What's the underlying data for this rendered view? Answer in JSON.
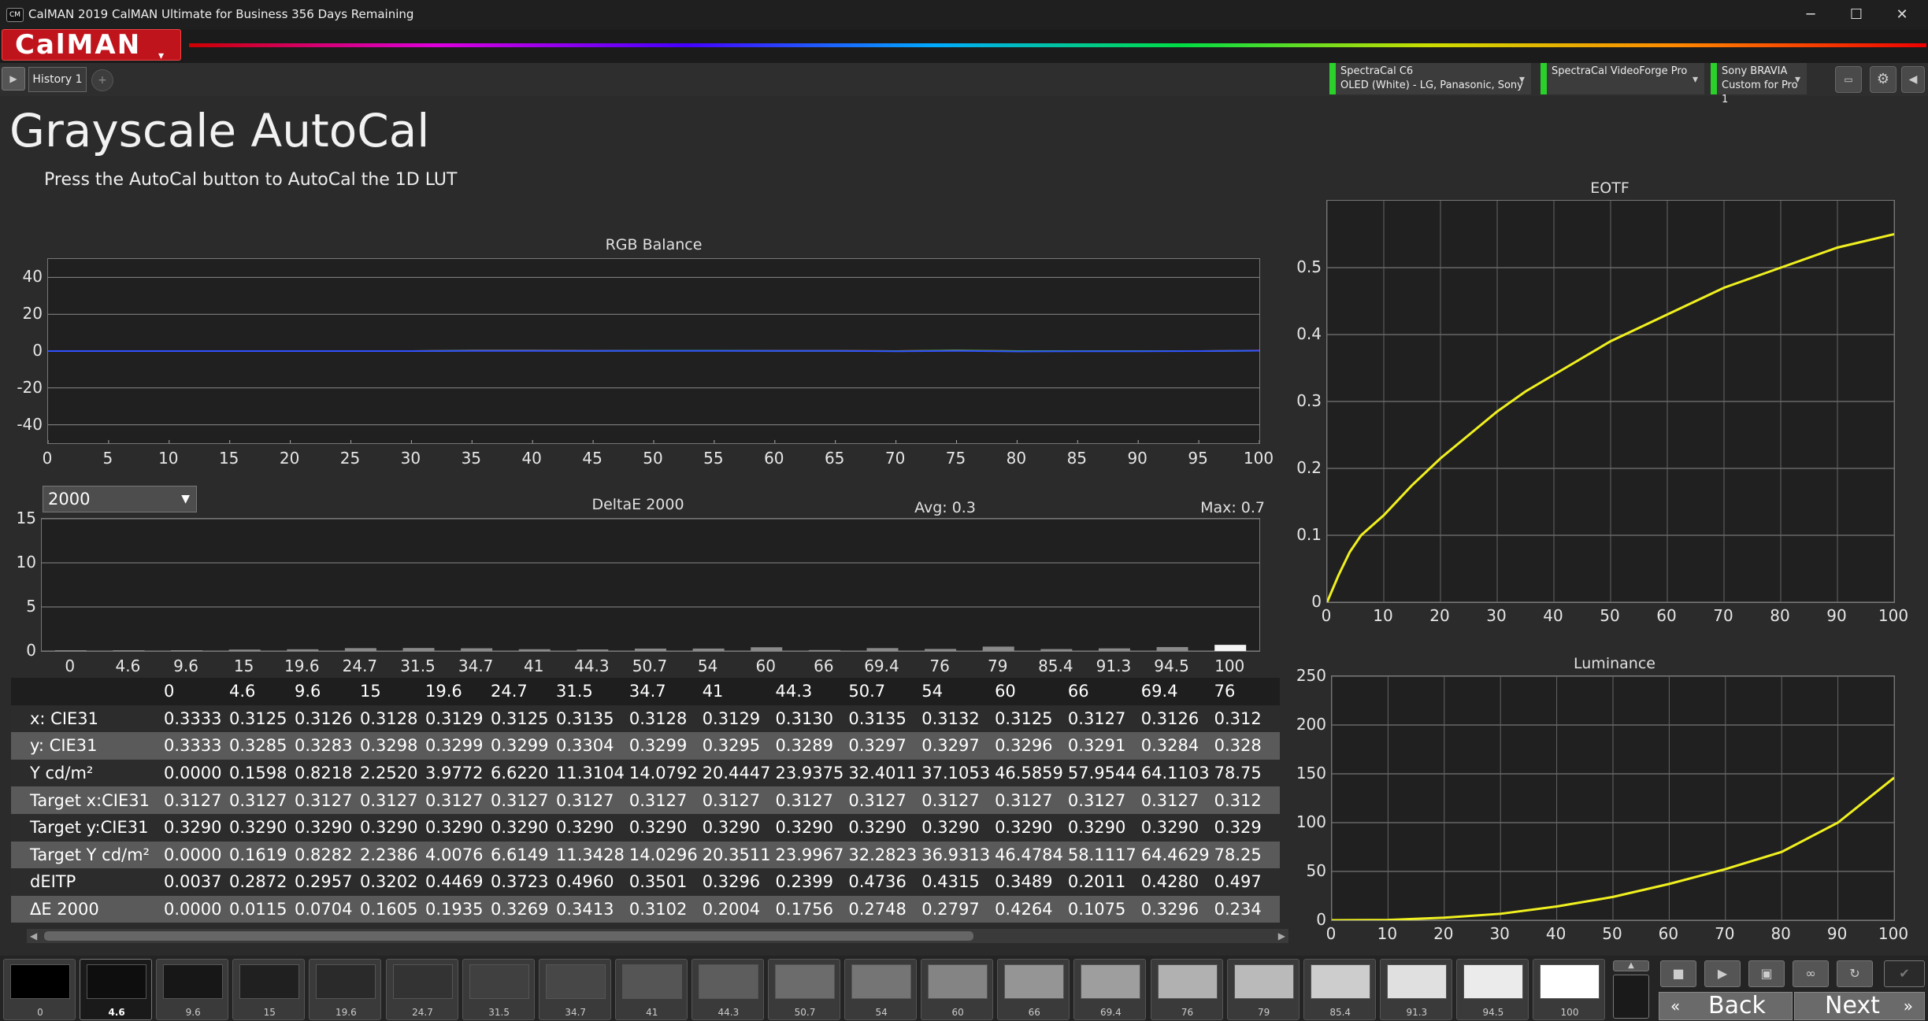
{
  "window": {
    "title": "CalMAN 2019 CalMAN Ultimate for Business 356 Days Remaining",
    "logo": "CM",
    "minimize": "─",
    "maximize": "☐",
    "close": "✕"
  },
  "app": {
    "brand": "CalMAN",
    "brand_caret": "▾",
    "tab_label": "History 1",
    "tab_arrow": "▶",
    "tab_add": "+"
  },
  "devices": [
    {
      "line1": "SpectraCal C6",
      "line2": "OLED (White) - LG, Panasonic, Sony",
      "status_color": "#2ad12a"
    },
    {
      "line1": "SpectraCal VideoForge Pro",
      "line2": "",
      "status_color": "#2ad12a"
    },
    {
      "line1": "Sony BRAVIA",
      "line2": "Custom for Pro 1",
      "status_color": "#2ad12a"
    }
  ],
  "toolbar": {
    "ddc_icon": "monitor-icon",
    "settings_icon": "gear-icon",
    "collapse_icon": "triangle-left-icon"
  },
  "page": {
    "title": "Grayscale AutoCal",
    "instruction": "Press the AutoCal button to AutoCal the 1D LUT"
  },
  "deltae_select": {
    "value": "2000"
  },
  "charts": {
    "rgb": {
      "title": "RGB Balance"
    },
    "deltae": {
      "title": "DeltaE 2000",
      "avg": "Avg: 0.3",
      "max": "Max: 0.7"
    },
    "eotf": {
      "title": "EOTF"
    },
    "lum": {
      "title": "Luminance"
    }
  },
  "chart_data": [
    {
      "type": "line",
      "title": "RGB Balance",
      "x": [
        0,
        5,
        10,
        15,
        20,
        25,
        30,
        35,
        40,
        45,
        50,
        55,
        60,
        65,
        70,
        75,
        80,
        85,
        90,
        95,
        100
      ],
      "xlim": [
        0,
        100
      ],
      "ylim": [
        -50,
        50
      ],
      "yticks": [
        40,
        20,
        0,
        -20,
        -40
      ],
      "series": [
        {
          "color": "#ff3030",
          "values": [
            0,
            0,
            0,
            0,
            0,
            0,
            0,
            0.3,
            0.3,
            0.2,
            0.2,
            0.2,
            0.2,
            0.2,
            0,
            0.4,
            0,
            0,
            0,
            0,
            0.3
          ]
        },
        {
          "color": "#30d030",
          "values": [
            0,
            0,
            0,
            0,
            0,
            0,
            0,
            0.2,
            0.2,
            0.1,
            0.2,
            0.2,
            0.1,
            0.1,
            0,
            0.3,
            0,
            0,
            0,
            0,
            0.2
          ]
        },
        {
          "color": "#3050ff",
          "values": [
            0,
            0,
            0,
            0,
            0,
            0,
            0,
            0.1,
            0.1,
            0.1,
            0.1,
            0.1,
            0.1,
            0.1,
            -0.1,
            0.1,
            -0.2,
            -0.1,
            -0.1,
            0,
            0.2
          ]
        }
      ]
    },
    {
      "type": "bar",
      "title": "DeltaE 2000",
      "categories": [
        "0",
        "4.6",
        "9.6",
        "15",
        "19.6",
        "24.7",
        "31.5",
        "34.7",
        "41",
        "44.3",
        "50.7",
        "54",
        "60",
        "66",
        "69.4",
        "76",
        "79",
        "85.4",
        "91.3",
        "94.5",
        "100"
      ],
      "values": [
        0.0,
        0.0115,
        0.0704,
        0.1605,
        0.1935,
        0.3269,
        0.3413,
        0.3102,
        0.2004,
        0.1756,
        0.2748,
        0.2797,
        0.4264,
        0.1075,
        0.3296,
        0.2343,
        0.5,
        0.22,
        0.3,
        0.45,
        0.7
      ],
      "ylim": [
        0,
        15
      ],
      "yticks": [
        15,
        10,
        5,
        0
      ]
    },
    {
      "type": "line",
      "title": "EOTF",
      "x": [
        0,
        2,
        4,
        6,
        8,
        10,
        15,
        20,
        25,
        30,
        35,
        40,
        45,
        50,
        55,
        60,
        65,
        70,
        75,
        80,
        85,
        90,
        95,
        100
      ],
      "values": [
        0,
        0.04,
        0.075,
        0.1,
        0.115,
        0.13,
        0.175,
        0.215,
        0.25,
        0.285,
        0.315,
        0.34,
        0.365,
        0.39,
        0.41,
        0.43,
        0.45,
        0.47,
        0.485,
        0.5,
        0.515,
        0.53,
        0.54,
        0.55
      ],
      "xlim": [
        0,
        100
      ],
      "ylim": [
        0,
        0.6
      ],
      "xticks": [
        0,
        10,
        20,
        30,
        40,
        50,
        60,
        70,
        80,
        90,
        100
      ],
      "yticks": [
        0.5,
        0.4,
        0.3,
        0.2,
        0.1,
        0
      ],
      "color": "#f0f020"
    },
    {
      "type": "line",
      "title": "Luminance",
      "x": [
        0,
        10,
        20,
        30,
        40,
        50,
        60,
        70,
        80,
        90,
        100
      ],
      "values": [
        0,
        0.3,
        2.6,
        6.6,
        14.1,
        23.9,
        37.2,
        52.4,
        70,
        100,
        146
      ],
      "xlim": [
        0,
        100
      ],
      "ylim": [
        0,
        250
      ],
      "xticks": [
        0,
        10,
        20,
        30,
        40,
        50,
        60,
        70,
        80,
        90,
        100
      ],
      "yticks": [
        250,
        200,
        150,
        100,
        50,
        0
      ],
      "color": "#f0f020"
    }
  ],
  "table": {
    "columns": [
      "0",
      "4.6",
      "9.6",
      "15",
      "19.6",
      "24.7",
      "31.5",
      "34.7",
      "41",
      "44.3",
      "50.7",
      "54",
      "60",
      "66",
      "69.4",
      "76"
    ],
    "rows": [
      {
        "label": "x: CIE31",
        "values": [
          "0.3333",
          "0.3125",
          "0.3126",
          "0.3128",
          "0.3129",
          "0.3125",
          "0.3135",
          "0.3128",
          "0.3129",
          "0.3130",
          "0.3135",
          "0.3132",
          "0.3125",
          "0.3127",
          "0.3126",
          "0.312"
        ]
      },
      {
        "label": "y: CIE31",
        "values": [
          "0.3333",
          "0.3285",
          "0.3283",
          "0.3298",
          "0.3299",
          "0.3299",
          "0.3304",
          "0.3299",
          "0.3295",
          "0.3289",
          "0.3297",
          "0.3297",
          "0.3296",
          "0.3291",
          "0.3284",
          "0.328"
        ]
      },
      {
        "label": "Y cd/m²",
        "values": [
          "0.0000",
          "0.1598",
          "0.8218",
          "2.2520",
          "3.9772",
          "6.6220",
          "11.3104",
          "14.0792",
          "20.4447",
          "23.9375",
          "32.4011",
          "37.1053",
          "46.5859",
          "57.9544",
          "64.1103",
          "78.75"
        ]
      },
      {
        "label": "Target x:CIE31",
        "values": [
          "0.3127",
          "0.3127",
          "0.3127",
          "0.3127",
          "0.3127",
          "0.3127",
          "0.3127",
          "0.3127",
          "0.3127",
          "0.3127",
          "0.3127",
          "0.3127",
          "0.3127",
          "0.3127",
          "0.3127",
          "0.312"
        ]
      },
      {
        "label": "Target y:CIE31",
        "values": [
          "0.3290",
          "0.3290",
          "0.3290",
          "0.3290",
          "0.3290",
          "0.3290",
          "0.3290",
          "0.3290",
          "0.3290",
          "0.3290",
          "0.3290",
          "0.3290",
          "0.3290",
          "0.3290",
          "0.3290",
          "0.329"
        ]
      },
      {
        "label": "Target Y cd/m²",
        "values": [
          "0.0000",
          "0.1619",
          "0.8282",
          "2.2386",
          "4.0076",
          "6.6149",
          "11.3428",
          "14.0296",
          "20.3511",
          "23.9967",
          "32.2823",
          "36.9313",
          "46.4784",
          "58.1117",
          "64.4629",
          "78.25"
        ]
      },
      {
        "label": "dEITP",
        "values": [
          "0.0037",
          "0.2872",
          "0.2957",
          "0.3202",
          "0.4469",
          "0.3723",
          "0.4960",
          "0.3501",
          "0.3296",
          "0.2399",
          "0.4736",
          "0.4315",
          "0.3489",
          "0.2011",
          "0.4280",
          "0.497"
        ]
      },
      {
        "label": "ΔE 2000",
        "values": [
          "0.0000",
          "0.0115",
          "0.0704",
          "0.1605",
          "0.1935",
          "0.3269",
          "0.3413",
          "0.3102",
          "0.2004",
          "0.1756",
          "0.2748",
          "0.2797",
          "0.4264",
          "0.1075",
          "0.3296",
          "0.234"
        ]
      }
    ]
  },
  "swatches": [
    {
      "label": "0",
      "gray": "#000000"
    },
    {
      "label": "4.6",
      "gray": "#0e0e0e"
    },
    {
      "label": "9.6",
      "gray": "#171717"
    },
    {
      "label": "15",
      "gray": "#202020"
    },
    {
      "label": "19.6",
      "gray": "#2a2a2a"
    },
    {
      "label": "24.7",
      "gray": "#333333"
    },
    {
      "label": "31.5",
      "gray": "#404040"
    },
    {
      "label": "34.7",
      "gray": "#474747"
    },
    {
      "label": "41",
      "gray": "#555555"
    },
    {
      "label": "44.3",
      "gray": "#5d5d5d"
    },
    {
      "label": "50.7",
      "gray": "#6c6c6c"
    },
    {
      "label": "54",
      "gray": "#757575"
    },
    {
      "label": "60",
      "gray": "#848484"
    },
    {
      "label": "66",
      "gray": "#959595"
    },
    {
      "label": "69.4",
      "gray": "#9e9e9e"
    },
    {
      "label": "76",
      "gray": "#b1b1b1"
    },
    {
      "label": "79",
      "gray": "#bababa"
    },
    {
      "label": "85.4",
      "gray": "#cdcdcd"
    },
    {
      "label": "91.3",
      "gray": "#e0e0e0"
    },
    {
      "label": "94.5",
      "gray": "#ebebeb"
    },
    {
      "label": "100",
      "gray": "#ffffff"
    }
  ],
  "selected_swatch": "4.6",
  "nav": {
    "back": "Back",
    "next": "Next"
  },
  "controls": [
    "stop-icon",
    "play-icon",
    "save-icon",
    "loop-icon",
    "refresh-icon",
    "check-icon"
  ]
}
